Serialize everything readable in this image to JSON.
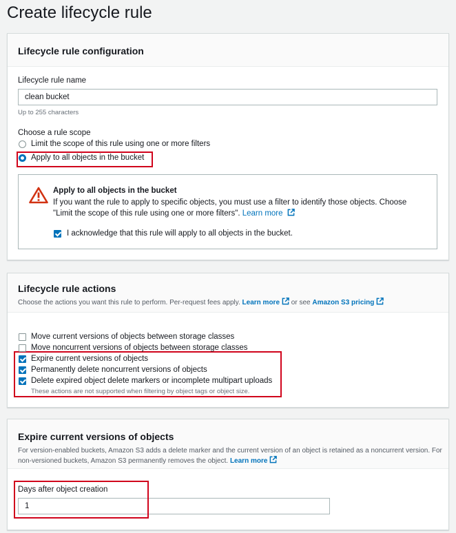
{
  "page_title": "Create lifecycle rule",
  "config": {
    "title": "Lifecycle rule configuration",
    "name_label": "Lifecycle rule name",
    "name_value": "clean bucket",
    "name_hint": "Up to 255 characters",
    "scope_label": "Choose a rule scope",
    "scope_options": [
      {
        "label": "Limit the scope of this rule using one or more filters",
        "selected": false
      },
      {
        "label": "Apply to all objects in the bucket",
        "selected": true
      }
    ],
    "alert": {
      "title": "Apply to all objects in the bucket",
      "body_line1": "If you want the rule to apply to specific objects, you must use a filter to identify those objects. Choose",
      "body_line2": "\"Limit the scope of this rule using one or more filters\".",
      "learn_more": "Learn more",
      "ack_label": "I acknowledge that this rule will apply to all objects in the bucket.",
      "ack_checked": true,
      "icon": "warning-icon"
    }
  },
  "actions": {
    "title": "Lifecycle rule actions",
    "desc_prefix": "Choose the actions you want this rule to perform. Per-request fees apply.",
    "learn_more": "Learn more",
    "or_see": "or see",
    "pricing_link": "Amazon S3 pricing",
    "options": [
      {
        "label": "Move current versions of objects between storage classes",
        "checked": false
      },
      {
        "label": "Move noncurrent versions of objects between storage classes",
        "checked": false
      },
      {
        "label": "Expire current versions of objects",
        "checked": true
      },
      {
        "label": "Permanently delete noncurrent versions of objects",
        "checked": true
      },
      {
        "label": "Delete expired object delete markers or incomplete multipart uploads",
        "checked": true
      }
    ],
    "options_note": "These actions are not supported when filtering by object tags or object size."
  },
  "expire": {
    "title": "Expire current versions of objects",
    "desc_line1": "For version-enabled buckets, Amazon S3 adds a delete marker and the current version of an object is retained as a noncurrent version. For",
    "desc_line2": "non-versioned buckets, Amazon S3 permanently removes the object.",
    "learn_more": "Learn more",
    "days_label": "Days after object creation",
    "days_value": "1"
  },
  "colors": {
    "accent": "#0073bb",
    "highlight": "#d0021b",
    "warning": "#d13212"
  }
}
